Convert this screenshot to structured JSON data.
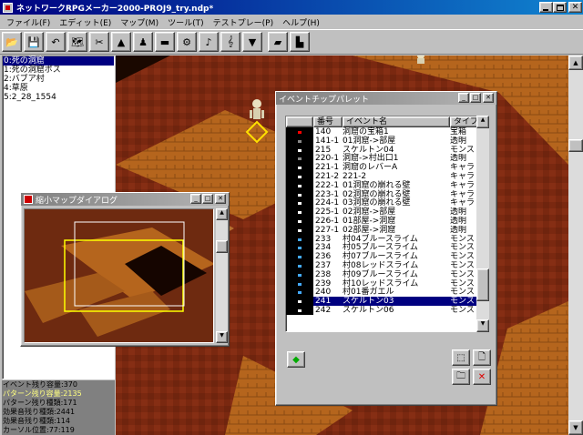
{
  "window": {
    "title": "ネットワークRPGメーカー2000-PROJ9_try.ndp*"
  },
  "menu": [
    "ファイル(F)",
    "エディット(E)",
    "マップ(M)",
    "ツール(T)",
    "テストプレー(P)",
    "ヘルプ(H)"
  ],
  "toolbar": {
    "buttons": [
      {
        "name": "open-button",
        "icon": "folder-icon",
        "glyph": "📂"
      },
      {
        "name": "save-button",
        "icon": "floppy-icon",
        "glyph": "💾"
      },
      {
        "name": "undo-button",
        "icon": "undo-icon",
        "glyph": "↶"
      },
      {
        "name": "map-properties-button",
        "icon": "map-props-icon",
        "glyph": "🗺"
      },
      {
        "name": "tool-button",
        "icon": "wrench-icon",
        "glyph": "✂"
      },
      {
        "name": "terrain-button",
        "icon": "mountain-icon",
        "glyph": "▲"
      },
      {
        "name": "character-button",
        "icon": "person-icon",
        "glyph": "♟"
      },
      {
        "name": "material-button",
        "icon": "box-icon",
        "glyph": "▬"
      },
      {
        "name": "script-button",
        "icon": "gear-icon",
        "glyph": "⚙"
      },
      {
        "name": "sound-button",
        "icon": "trumpet-icon",
        "glyph": "♪"
      },
      {
        "name": "music-button",
        "icon": "clef-icon",
        "glyph": "𝄞"
      },
      {
        "name": "test-play-button",
        "icon": "play-icon",
        "glyph": "▼"
      },
      {
        "name": "layer-map-button",
        "icon": "map-layer-icon",
        "glyph": "▰"
      },
      {
        "name": "layer-event-button",
        "icon": "event-layer-icon",
        "glyph": "▙"
      }
    ]
  },
  "maplist": {
    "items": [
      "0:死の洞窟",
      "1:死の洞窟ボス",
      "2:バブア村",
      "4:草原",
      "5:2_28_1554"
    ]
  },
  "stats": [
    "イベント残り容量:370",
    "パターン残り容量:2135",
    "パターン残り種類:171",
    "効果音残り種類:2441",
    "効果音残り種類:114",
    "カーソル位置:77:119"
  ],
  "minimap": {
    "title": "縮小マップダイアログ"
  },
  "palette": {
    "title": "イベントチップパレット",
    "columns": [
      "",
      "番号",
      "イベント名",
      "タイプ"
    ],
    "rows": [
      [
        "140",
        "洞窟の宝箱1",
        "宝箱"
      ],
      [
        "141-1",
        "01洞窟->部屋",
        "透明"
      ],
      [
        "215",
        "スケルトン04",
        "モンス"
      ],
      [
        "220-1",
        "洞窟->村出口1",
        "透明"
      ],
      [
        "221-1",
        "洞窟のレバーA",
        "キャラ"
      ],
      [
        "221-2",
        "221-2",
        "キャラ"
      ],
      [
        "222-1",
        "01洞窟の崩れる壁",
        "キャラ"
      ],
      [
        "223-1",
        "02洞窟の崩れる壁",
        "キャラ"
      ],
      [
        "224-1",
        "03洞窟の崩れる壁",
        "キャラ"
      ],
      [
        "225-1",
        "02洞窟->部屋",
        "透明"
      ],
      [
        "226-1",
        "01部屋->洞窟",
        "透明"
      ],
      [
        "227-1",
        "02部屋->洞窟",
        "透明"
      ],
      [
        "233",
        "村04ブルースライム",
        "モンス"
      ],
      [
        "234",
        "村05ブルースライム",
        "モンス"
      ],
      [
        "236",
        "村07ブルースライム",
        "モンス"
      ],
      [
        "237",
        "村08レッドスライム",
        "モンス"
      ],
      [
        "238",
        "村09ブルースライム",
        "モンス"
      ],
      [
        "239",
        "村10レッドスライム",
        "モンス"
      ],
      [
        "240",
        "村01番ガエル",
        "モンス"
      ],
      [
        "241",
        "スケルトン03",
        "モンス"
      ],
      [
        "242",
        "スケルトン06",
        "モンス"
      ]
    ],
    "selected_row": 19
  },
  "colors": {
    "title_active": "#000080",
    "map_floor": "#7a2810",
    "wall": "#b5651d",
    "selection": "#000080"
  }
}
